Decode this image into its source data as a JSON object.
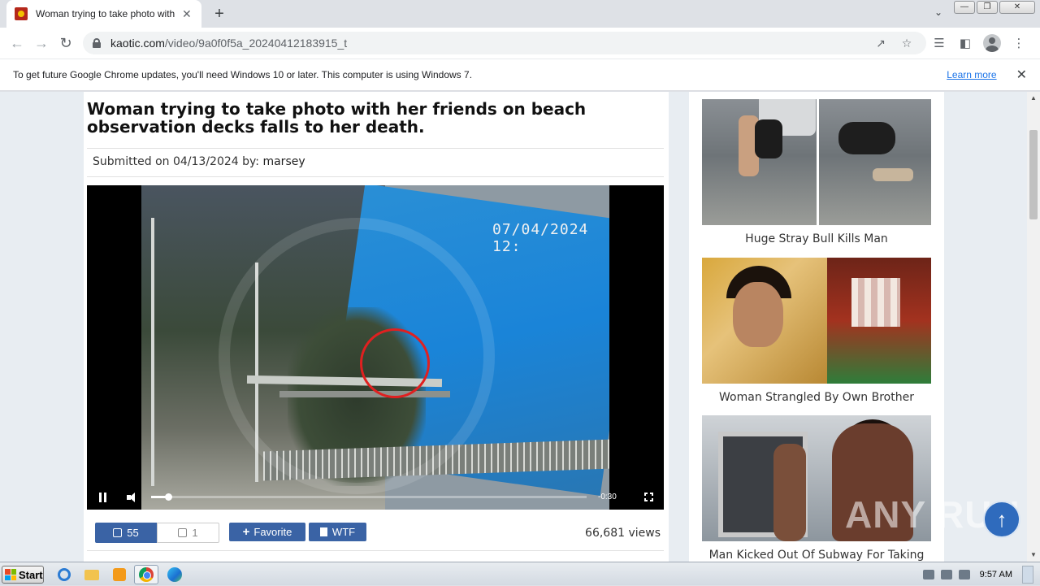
{
  "browser": {
    "tab_title": "Woman trying to take photo with her",
    "new_tab": "+",
    "tab_close": "✕",
    "url_domain": "kaotic.com",
    "url_path": "/video/9a0f0f5a_20240412183915_t",
    "win_minimize": "—",
    "win_maximize": "❐",
    "win_close": "✕"
  },
  "infobar": {
    "message": "To get future Google Chrome updates, you'll need Windows 10 or later. This computer is using Windows 7.",
    "learn_more": "Learn more",
    "close": "✕"
  },
  "article": {
    "title": "Woman trying to take photo with her friends on beach observation decks falls to her death.",
    "submitted_prefix": "Submitted on 04/13/2024 by:",
    "author": "marsey"
  },
  "video": {
    "timestamp_overlay": "07/04/2024 12:",
    "time_remaining": "-0:30",
    "progress": 0.04
  },
  "actions": {
    "likes": "55",
    "dislikes": "1",
    "favorite_label": "Favorite",
    "wtf_label": "WTF",
    "views": "66,681 views"
  },
  "sidebar": {
    "items": [
      {
        "caption": "Huge Stray Bull Kills Man"
      },
      {
        "caption": "Woman Strangled By Own Brother"
      },
      {
        "caption": "Man Kicked Out Of Subway For Taking"
      }
    ]
  },
  "overlay": {
    "watermark": "ANY RUN",
    "scroll_top": "↑"
  },
  "taskbar": {
    "start": "Start",
    "clock": "9:57 AM"
  },
  "colors": {
    "button_blue": "#3a63a5",
    "page_bg": "#e8edf2",
    "highlight_red": "#e02020"
  }
}
